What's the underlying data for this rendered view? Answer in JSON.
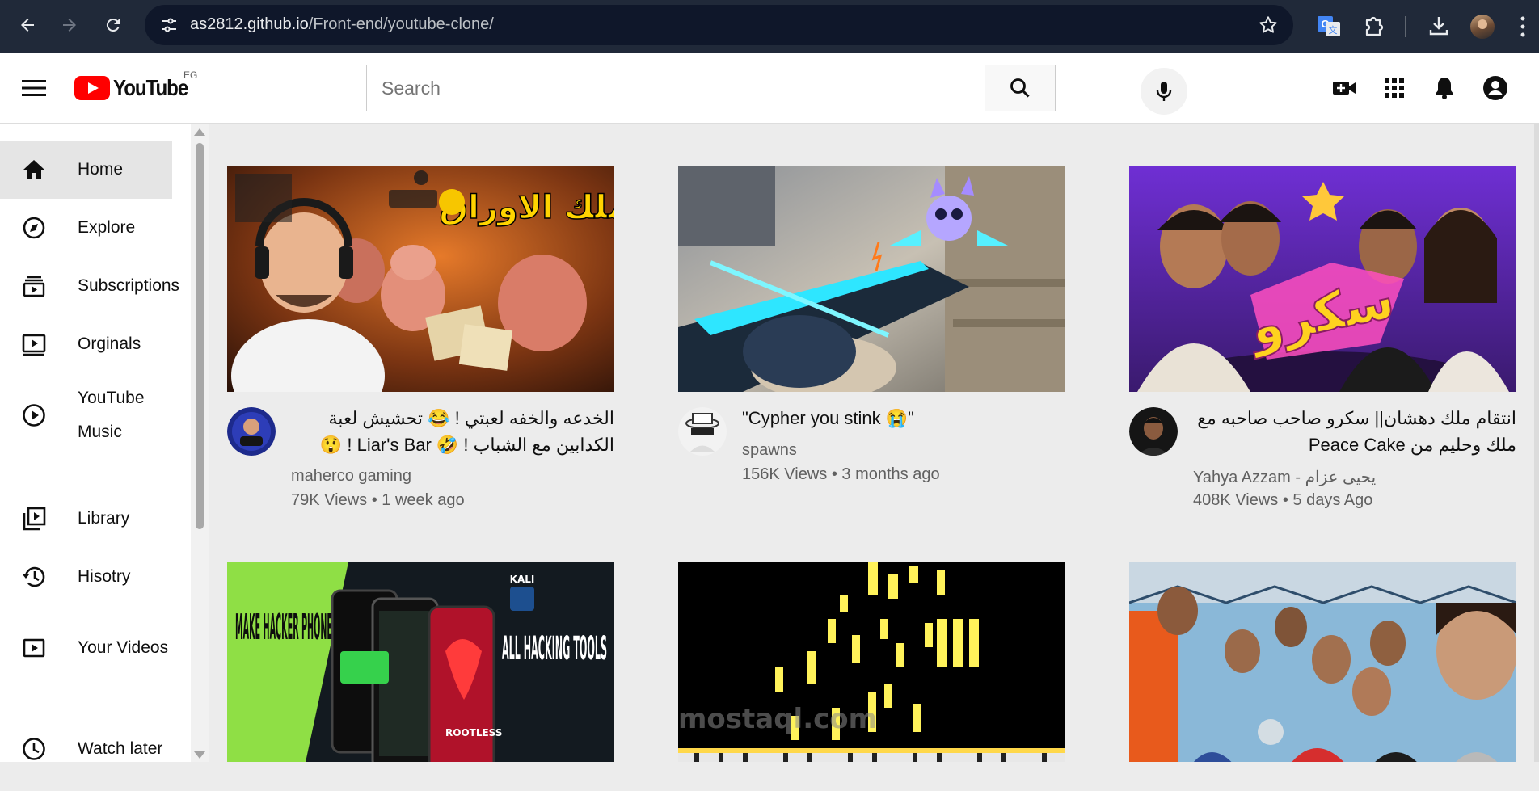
{
  "browser": {
    "url_host": "as2812.github.io",
    "url_path": "/Front-end/youtube-clone/"
  },
  "header": {
    "logo_text": "YouTube",
    "country_code": "EG",
    "search_placeholder": "Search"
  },
  "sidebar": {
    "items": [
      {
        "label": "Home",
        "icon": "home-icon",
        "active": true
      },
      {
        "label": "Explore",
        "icon": "compass-icon"
      },
      {
        "label": "Subscriptions",
        "icon": "subscriptions-icon"
      },
      {
        "label": "Orginals",
        "icon": "originals-icon"
      },
      {
        "label": "YouTube Music",
        "icon": "music-play-icon"
      },
      {
        "label": "Library",
        "icon": "library-icon"
      },
      {
        "label": "Hisotry",
        "icon": "history-icon"
      },
      {
        "label": "Your Videos",
        "icon": "your-videos-icon"
      },
      {
        "label": "Watch later",
        "icon": "clock-icon"
      }
    ]
  },
  "videos": [
    {
      "title": "الخدعه والخفه لعبتي ! 😂 تحشيش لعبة الكدابين مع الشباب ! 🤣 Liar's Bar ! 😲",
      "channel": "maherco gaming",
      "views": "79K Views",
      "age": "1 week ago",
      "thumb_text": "ملك الاوراق !"
    },
    {
      "title": "\"Cypher you stink 😭\"",
      "channel": "spawns",
      "views": "156K Views",
      "age": "3 months ago"
    },
    {
      "title": "انتقام ملك دهشان|| سكرو صاحب صاحبه مع ملك وحليم من Peace Cake",
      "channel": "Yahya Azzam - يحيى عزام",
      "views": "408K Views",
      "age": "5 days Ago",
      "thumb_text": "سكرو"
    },
    {
      "thumb_left": "MAKE HACKER PHONE",
      "thumb_right": "ALL HACKING TOOLS",
      "badge": "KALI",
      "sub": "ROOTLESS"
    },
    {
      "watermark": "mostaql.com"
    },
    {}
  ],
  "colors": {
    "brand_red": "#ff0000",
    "chrome_bg": "#202939",
    "page_bg": "#ececec"
  }
}
